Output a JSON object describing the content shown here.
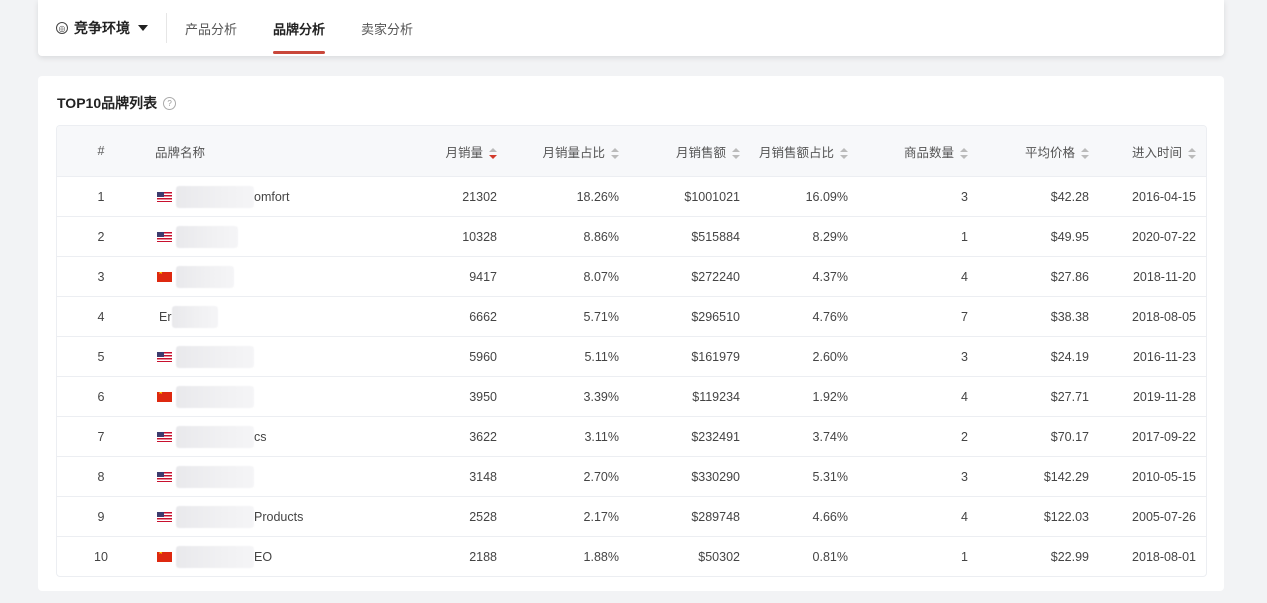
{
  "nav": {
    "env_label": "竞争环境",
    "tabs": [
      {
        "label": "产品分析",
        "active": false
      },
      {
        "label": "品牌分析",
        "active": true
      },
      {
        "label": "卖家分析",
        "active": false
      }
    ]
  },
  "card": {
    "title": "TOP10品牌列表"
  },
  "table": {
    "headers": {
      "idx": "#",
      "brand": "品牌名称",
      "sales": "月销量",
      "sales_share": "月销量占比",
      "revenue": "月销售额",
      "revenue_share": "月销售额占比",
      "count": "商品数量",
      "avg_price": "平均价格",
      "entry_time": "进入时间"
    },
    "sort": {
      "column": "sales",
      "direction": "desc"
    },
    "rows": [
      {
        "idx": "1",
        "flag": "us",
        "brand_visible": "omfort",
        "sales": "21302",
        "sales_share": "18.26%",
        "revenue": "$1001021",
        "revenue_share": "16.09%",
        "count": "3",
        "avg_price": "$42.28",
        "entry_time": "2016-04-15"
      },
      {
        "idx": "2",
        "flag": "us",
        "brand_visible": "",
        "sales": "10328",
        "sales_share": "8.86%",
        "revenue": "$515884",
        "revenue_share": "8.29%",
        "count": "1",
        "avg_price": "$49.95",
        "entry_time": "2020-07-22"
      },
      {
        "idx": "3",
        "flag": "cn",
        "brand_visible": "",
        "sales": "9417",
        "sales_share": "8.07%",
        "revenue": "$272240",
        "revenue_share": "4.37%",
        "count": "4",
        "avg_price": "$27.86",
        "entry_time": "2018-11-20"
      },
      {
        "idx": "4",
        "flag": "none",
        "brand_visible": "Er",
        "sales": "6662",
        "sales_share": "5.71%",
        "revenue": "$296510",
        "revenue_share": "4.76%",
        "count": "7",
        "avg_price": "$38.38",
        "entry_time": "2018-08-05"
      },
      {
        "idx": "5",
        "flag": "us",
        "brand_visible": "",
        "sales": "5960",
        "sales_share": "5.11%",
        "revenue": "$161979",
        "revenue_share": "2.60%",
        "count": "3",
        "avg_price": "$24.19",
        "entry_time": "2016-11-23"
      },
      {
        "idx": "6",
        "flag": "cn",
        "brand_visible": "",
        "sales": "3950",
        "sales_share": "3.39%",
        "revenue": "$119234",
        "revenue_share": "1.92%",
        "count": "4",
        "avg_price": "$27.71",
        "entry_time": "2019-11-28"
      },
      {
        "idx": "7",
        "flag": "us",
        "brand_visible": "cs",
        "sales": "3622",
        "sales_share": "3.11%",
        "revenue": "$232491",
        "revenue_share": "3.74%",
        "count": "2",
        "avg_price": "$70.17",
        "entry_time": "2017-09-22"
      },
      {
        "idx": "8",
        "flag": "us",
        "brand_visible": "",
        "sales": "3148",
        "sales_share": "2.70%",
        "revenue": "$330290",
        "revenue_share": "5.31%",
        "count": "3",
        "avg_price": "$142.29",
        "entry_time": "2010-05-15"
      },
      {
        "idx": "9",
        "flag": "us",
        "brand_visible": "Products",
        "sales": "2528",
        "sales_share": "2.17%",
        "revenue": "$289748",
        "revenue_share": "4.66%",
        "count": "4",
        "avg_price": "$122.03",
        "entry_time": "2005-07-26"
      },
      {
        "idx": "10",
        "flag": "cn",
        "brand_visible": "EO",
        "sales": "2188",
        "sales_share": "1.88%",
        "revenue": "$50302",
        "revenue_share": "0.81%",
        "count": "1",
        "avg_price": "$22.99",
        "entry_time": "2018-08-01"
      }
    ]
  },
  "colors": {
    "accent": "#c9473a",
    "sort_active": "#d23a2c"
  }
}
